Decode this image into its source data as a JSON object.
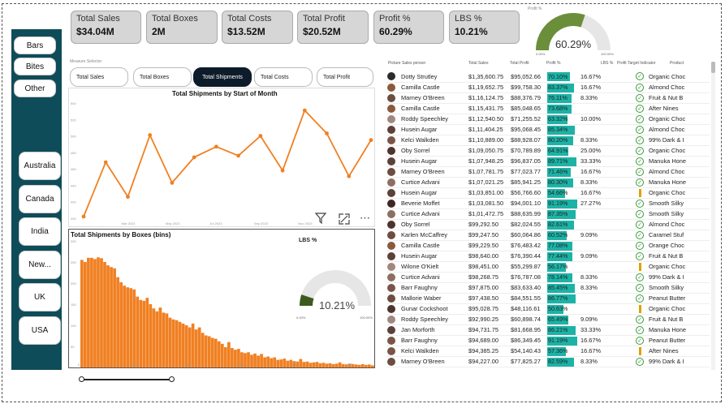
{
  "kpis": [
    {
      "label": "Total Sales",
      "value": "$34.04M"
    },
    {
      "label": "Total Boxes",
      "value": "2M"
    },
    {
      "label": "Total Costs",
      "value": "$13.52M"
    },
    {
      "label": "Total Profit",
      "value": "$20.52M"
    },
    {
      "label": "Profit %",
      "value": "60.29%"
    },
    {
      "label": "LBS %",
      "value": "10.21%"
    }
  ],
  "profit_gauge": {
    "title": "Profit %",
    "value": "60.29%",
    "fraction": 0.6029,
    "min": "0.00%",
    "max": "100.00%",
    "fill": "#6b8e3a",
    "track": "#e6e6e6"
  },
  "product_slicer": [
    "Bars",
    "Bites",
    "Other"
  ],
  "country_slicer": [
    "Australia",
    "Canada",
    "India",
    "New...",
    "UK",
    "USA"
  ],
  "measure_selector": {
    "label": "Measure Selector",
    "tabs": [
      "Total Sales",
      "Total Boxes",
      "Total Shipments",
      "Total Costs",
      "Total Profit"
    ],
    "active": "Total Shipments"
  },
  "line_chart": {
    "title": "Total Shipments by Start of Month",
    "chart_data": {
      "type": "line",
      "x": [
        "Jan 2023",
        "Feb 2023",
        "Mar 2023",
        "Apr 2023",
        "May 2023",
        "Jun 2023",
        "Jul 2023",
        "Aug 2023",
        "Sep 2023",
        "Oct 2023",
        "Nov 2023",
        "Dec 2023",
        "Jan 2024",
        "Feb 2024"
      ],
      "xticks": [
        "Mar 2023",
        "May 2023",
        "Jul 2023",
        "Sep 2023",
        "Nov 2023"
      ],
      "values": [
        402,
        468,
        426,
        501,
        443,
        474,
        487,
        476,
        500,
        458,
        531,
        503,
        451,
        495
      ],
      "ylim": [
        400,
        540
      ],
      "yticks": [
        "400",
        "420",
        "440",
        "460",
        "480",
        "500",
        "520",
        "540"
      ],
      "color": "#f08022"
    }
  },
  "histogram": {
    "title": "Total Shipments by Boxes (bins)",
    "chart_data": {
      "type": "bar",
      "values": [
        255,
        250,
        260,
        260,
        257,
        261,
        259,
        250,
        242,
        238,
        235,
        214,
        202,
        194,
        190,
        188,
        185,
        168,
        160,
        158,
        165,
        150,
        140,
        133,
        142,
        130,
        128,
        118,
        114,
        112,
        108,
        104,
        100,
        95,
        104,
        90,
        95,
        82,
        76,
        74,
        70,
        68,
        62,
        56,
        48,
        60,
        46,
        42,
        44,
        36,
        34,
        36,
        30,
        33,
        28,
        32,
        24,
        26,
        22,
        24,
        18,
        19,
        21,
        16,
        18,
        15,
        14,
        20,
        13,
        14,
        11,
        12,
        13,
        10,
        11,
        9,
        10,
        8,
        9,
        12,
        8,
        7,
        9,
        8,
        7,
        6,
        8,
        6,
        7,
        5
      ],
      "ylim": [
        0,
        300
      ],
      "yticks": [
        "0",
        "50",
        "100",
        "150",
        "200",
        "250",
        "300"
      ],
      "xticks": [
        "0",
        "200",
        "400",
        "600",
        "800",
        "1000"
      ],
      "xmax": 1100,
      "color": "#f08022"
    }
  },
  "lbs_gauge": {
    "title": "LBS %",
    "value": "10.21%",
    "fraction": 0.1021,
    "min": "0.00%",
    "max": "100.00%",
    "fill": "#3d5a1e",
    "track": "#e6e6e6"
  },
  "table": {
    "headers": [
      "Picture",
      "Sales person",
      "Total Sales",
      "Total Profit",
      "Profit %",
      "LBS %",
      "Profit Target Indicator",
      "Product"
    ],
    "rows": [
      {
        "avatar": "#2b2b2b",
        "name": "Dotty Strutley",
        "sales": "$1,35,600.75",
        "profit": "$95,052.66",
        "pct": "70.10%",
        "pv": 0.701,
        "lbs": "16.67%",
        "ind": "check",
        "product": "Organic Choc"
      },
      {
        "avatar": "#8a5a3c",
        "name": "Camilla Castle",
        "sales": "$1,19,652.75",
        "profit": "$99,758.30",
        "pct": "83.37%",
        "pv": 0.834,
        "lbs": "16.67%",
        "ind": "check",
        "product": "Almond Choc"
      },
      {
        "avatar": "#6d4c41",
        "name": "Marney O'Breen",
        "sales": "$1,16,124.75",
        "profit": "$88,376.79",
        "pct": "76.11%",
        "pv": 0.761,
        "lbs": "8.33%",
        "ind": "check",
        "product": "Fruit & Nut B"
      },
      {
        "avatar": "#8a5a3c",
        "name": "Camilla Castle",
        "sales": "$1,15,431.75",
        "profit": "$85,048.65",
        "pct": "73.68%",
        "pv": 0.737,
        "lbs": "",
        "ind": "check",
        "product": "After Nines"
      },
      {
        "avatar": "#a1887f",
        "name": "Roddy Speechley",
        "sales": "$1,12,540.50",
        "profit": "$71,255.52",
        "pct": "63.32%",
        "pv": 0.633,
        "lbs": "10.00%",
        "ind": "check",
        "product": "Organic Choc"
      },
      {
        "avatar": "#5d4037",
        "name": "Husein Augar",
        "sales": "$1,11,404.25",
        "profit": "$95,068.45",
        "pct": "85.34%",
        "pv": 0.853,
        "lbs": "",
        "ind": "check",
        "product": "Almond Choc"
      },
      {
        "avatar": "#795548",
        "name": "Kelci Walkden",
        "sales": "$1,10,889.00",
        "profit": "$88,928.07",
        "pct": "80.20%",
        "pv": 0.802,
        "lbs": "8.33%",
        "ind": "check",
        "product": "99% Dark & I"
      },
      {
        "avatar": "#4e342e",
        "name": "Oby Sorrel",
        "sales": "$1,09,050.75",
        "profit": "$70,789.89",
        "pct": "64.91%",
        "pv": 0.649,
        "lbs": "25.00%",
        "ind": "check",
        "product": "Organic Choc"
      },
      {
        "avatar": "#5d4037",
        "name": "Husein Augar",
        "sales": "$1,07,948.25",
        "profit": "$96,837.05",
        "pct": "89.71%",
        "pv": 0.897,
        "lbs": "33.33%",
        "ind": "check",
        "product": "Manuka Hone"
      },
      {
        "avatar": "#6d4c41",
        "name": "Marney O'Breen",
        "sales": "$1,07,781.75",
        "profit": "$77,023.77",
        "pct": "71.46%",
        "pv": 0.715,
        "lbs": "16.67%",
        "ind": "check",
        "product": "Almond Choc"
      },
      {
        "avatar": "#8d6e63",
        "name": "Curtice Advani",
        "sales": "$1,07,021.25",
        "profit": "$85,941.25",
        "pct": "80.30%",
        "pv": 0.803,
        "lbs": "8.33%",
        "ind": "check",
        "product": "Manuka Hone"
      },
      {
        "avatar": "#5d4037",
        "name": "Husein Augar",
        "sales": "$1,03,851.00",
        "profit": "$56,766.60",
        "pct": "54.66%",
        "pv": 0.547,
        "lbs": "16.67%",
        "ind": "excl",
        "product": "Organic Choc"
      },
      {
        "avatar": "#3e2723",
        "name": "Beverie Moffet",
        "sales": "$1,03,081.50",
        "profit": "$94,001.10",
        "pct": "91.19%",
        "pv": 0.912,
        "lbs": "27.27%",
        "ind": "check",
        "product": "Smooth Silky"
      },
      {
        "avatar": "#8d6e63",
        "name": "Curtice Advani",
        "sales": "$1,01,472.75",
        "profit": "$88,635.99",
        "pct": "87.35%",
        "pv": 0.874,
        "lbs": "",
        "ind": "check",
        "product": "Smooth Silky"
      },
      {
        "avatar": "#4e342e",
        "name": "Oby Sorrel",
        "sales": "$99,292.50",
        "profit": "$82,024.55",
        "pct": "82.61%",
        "pv": 0.826,
        "lbs": "",
        "ind": "check",
        "product": "Almond Choc"
      },
      {
        "avatar": "#6d4c41",
        "name": "Karlen McCaffrey",
        "sales": "$99,247.50",
        "profit": "$60,064.86",
        "pct": "60.52%",
        "pv": 0.605,
        "lbs": "9.09%",
        "ind": "check",
        "product": "Caramel Stuf"
      },
      {
        "avatar": "#8a5a3c",
        "name": "Camilla Castle",
        "sales": "$99,229.50",
        "profit": "$76,483.42",
        "pct": "77.08%",
        "pv": 0.771,
        "lbs": "",
        "ind": "check",
        "product": "Orange Choc"
      },
      {
        "avatar": "#5d4037",
        "name": "Husein Augar",
        "sales": "$98,640.00",
        "profit": "$76,390.44",
        "pct": "77.44%",
        "pv": 0.774,
        "lbs": "9.09%",
        "ind": "check",
        "product": "Fruit & Nut B"
      },
      {
        "avatar": "#a1887f",
        "name": "Wilone O'Kielt",
        "sales": "$98,451.00",
        "profit": "$55,299.87",
        "pct": "56.17%",
        "pv": 0.562,
        "lbs": "",
        "ind": "excl",
        "product": "Organic Choc"
      },
      {
        "avatar": "#8d6e63",
        "name": "Curtice Advani",
        "sales": "$98,268.75",
        "profit": "$76,787.08",
        "pct": "78.14%",
        "pv": 0.781,
        "lbs": "8.33%",
        "ind": "check",
        "product": "99% Dark & I"
      },
      {
        "avatar": "#795548",
        "name": "Barr Faughny",
        "sales": "$97,875.00",
        "profit": "$83,633.40",
        "pct": "85.45%",
        "pv": 0.855,
        "lbs": "8.33%",
        "ind": "check",
        "product": "Smooth Silky"
      },
      {
        "avatar": "#6d4c41",
        "name": "Mallorie Waber",
        "sales": "$97,438.50",
        "profit": "$84,551.55",
        "pct": "86.77%",
        "pv": 0.868,
        "lbs": "",
        "ind": "check",
        "product": "Peanut Butter"
      },
      {
        "avatar": "#4e342e",
        "name": "Gunar Cockshoot",
        "sales": "$95,028.75",
        "profit": "$48,116.61",
        "pct": "50.63%",
        "pv": 0.506,
        "lbs": "",
        "ind": "excl",
        "product": "Organic Choc"
      },
      {
        "avatar": "#a1887f",
        "name": "Roddy Speechley",
        "sales": "$92,990.25",
        "profit": "$60,898.74",
        "pct": "65.49%",
        "pv": 0.655,
        "lbs": "9.09%",
        "ind": "check",
        "product": "Fruit & Nut B"
      },
      {
        "avatar": "#5d4037",
        "name": "Jan Morforth",
        "sales": "$94,731.75",
        "profit": "$81,668.95",
        "pct": "86.21%",
        "pv": 0.862,
        "lbs": "33.33%",
        "ind": "check",
        "product": "Manuka Hone"
      },
      {
        "avatar": "#795548",
        "name": "Barr Faughny",
        "sales": "$94,689.00",
        "profit": "$86,349.45",
        "pct": "91.19%",
        "pv": 0.912,
        "lbs": "16.67%",
        "ind": "check",
        "product": "Peanut Butter"
      },
      {
        "avatar": "#795548",
        "name": "Kelci Walkden",
        "sales": "$94,385.25",
        "profit": "$54,140.43",
        "pct": "57.36%",
        "pv": 0.574,
        "lbs": "16.67%",
        "ind": "excl",
        "product": "After Nines"
      },
      {
        "avatar": "#6d4c41",
        "name": "Marney O'Breen",
        "sales": "$94,227.00",
        "profit": "$77,825.27",
        "pct": "82.59%",
        "pv": 0.826,
        "lbs": "8.33%",
        "ind": "check",
        "product": "99% Dark & I"
      }
    ]
  }
}
